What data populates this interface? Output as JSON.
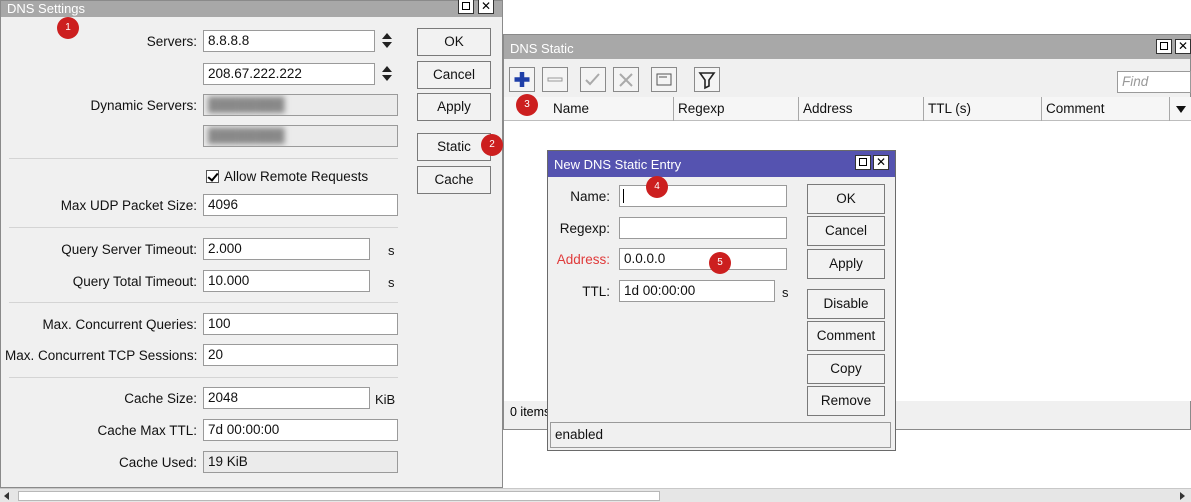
{
  "dns_settings": {
    "title": "DNS Settings",
    "servers_label": "Servers:",
    "servers": [
      "8.8.8.8",
      "208.67.222.222"
    ],
    "dynamic_servers_label": "Dynamic Servers:",
    "allow_remote_label": "Allow Remote Requests",
    "allow_remote_checked": true,
    "max_udp_label": "Max UDP Packet Size:",
    "max_udp_value": "4096",
    "query_server_timeout_label": "Query Server Timeout:",
    "query_server_timeout_value": "2.000",
    "query_total_timeout_label": "Query Total Timeout:",
    "query_total_timeout_value": "10.000",
    "seconds_unit": "s",
    "max_concurrent_queries_label": "Max. Concurrent Queries:",
    "max_concurrent_queries_value": "100",
    "max_concurrent_tcp_label": "Max. Concurrent TCP Sessions:",
    "max_concurrent_tcp_value": "20",
    "cache_size_label": "Cache Size:",
    "cache_size_value": "2048",
    "cache_size_unit": "KiB",
    "cache_max_ttl_label": "Cache Max TTL:",
    "cache_max_ttl_value": "7d 00:00:00",
    "cache_used_label": "Cache Used:",
    "cache_used_value": "19 KiB",
    "buttons": {
      "ok": "OK",
      "cancel": "Cancel",
      "apply": "Apply",
      "static": "Static",
      "cache": "Cache"
    }
  },
  "dns_static": {
    "title": "DNS Static",
    "find_placeholder": "Find",
    "columns": [
      "Name",
      "Regexp",
      "Address",
      "TTL (s)",
      "Comment"
    ],
    "items_count": "0 items"
  },
  "new_entry": {
    "title": "New DNS Static Entry",
    "name_label": "Name:",
    "name_value": "",
    "regexp_label": "Regexp:",
    "regexp_value": "",
    "address_label": "Address:",
    "address_value": "0.0.0.0",
    "ttl_label": "TTL:",
    "ttl_value": "1d 00:00:00",
    "ttl_unit": "s",
    "status": "enabled",
    "buttons": {
      "ok": "OK",
      "cancel": "Cancel",
      "apply": "Apply",
      "disable": "Disable",
      "comment": "Comment",
      "copy": "Copy",
      "remove": "Remove"
    }
  },
  "badges": [
    "1",
    "2",
    "3",
    "4",
    "5"
  ],
  "colors": {
    "badge": "#cc1f1f",
    "dialog_title": "#5553b0",
    "inactive_title": "#a8a8a8",
    "add_icon": "#1f3fa8",
    "required_label": "#e03a3a"
  },
  "icons": [
    "add-icon",
    "remove-icon",
    "enable-icon",
    "disable-icon",
    "comment-icon",
    "filter-icon",
    "sort-dropdown-icon",
    "close-icon",
    "maximize-icon",
    "spinner-icon"
  ]
}
